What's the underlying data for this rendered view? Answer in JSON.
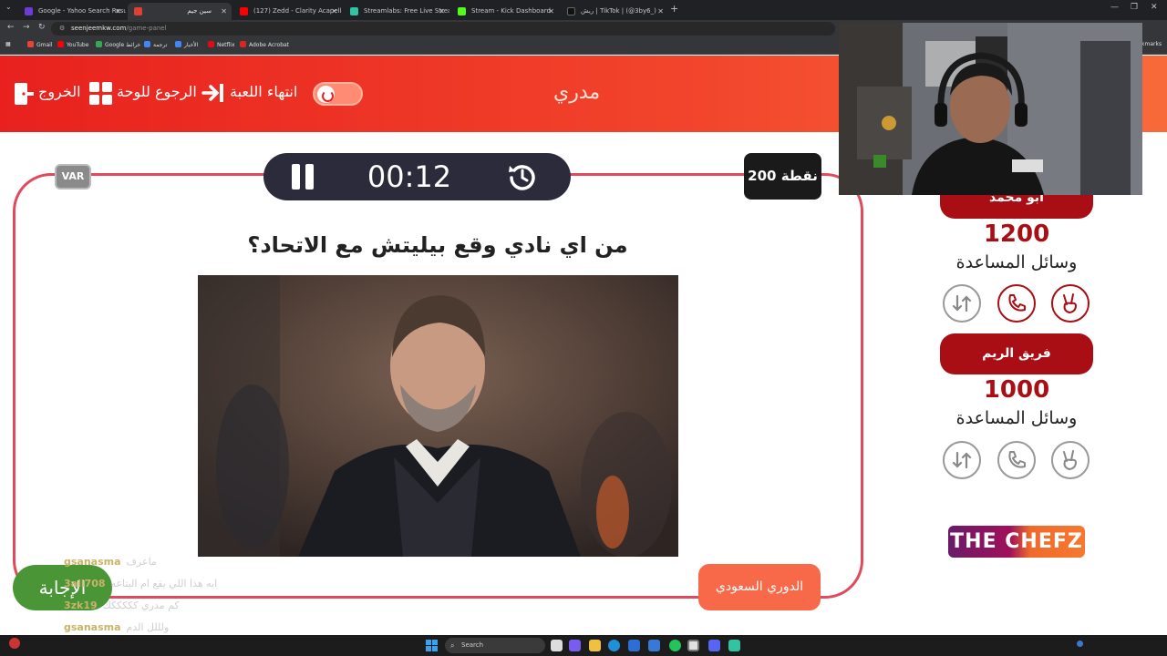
{
  "browser": {
    "tabs": [
      {
        "title": "Google - Yahoo Search Results",
        "color": "#6e3bd6",
        "active": false
      },
      {
        "title": "سين جيم",
        "color": "#e04030",
        "active": true
      },
      {
        "title": "(127) Zedd - Clarity Acapella C",
        "color": "#ff0000",
        "active": false
      },
      {
        "title": "Streamlabs: Free Live Streaming",
        "color": "#31c3a2",
        "active": false
      },
      {
        "title": "Stream - Kick Dashboard",
        "color": "#53fc18",
        "active": false
      },
      {
        "title": "ريش | TikTok | (@3by6_)",
        "color": "#111111",
        "active": false
      }
    ],
    "url_host": "seenjeemkw.com",
    "url_path": "/game-panel",
    "bookmarks": [
      {
        "label": "Gmail",
        "color": "#ea4335"
      },
      {
        "label": "YouTube",
        "color": "#ff0000"
      },
      {
        "label": "Google خرائط",
        "color": "#34a853"
      },
      {
        "label": "ترجمة",
        "color": "#4285f4"
      },
      {
        "label": "الأخبار",
        "color": "#4285f4"
      },
      {
        "label": "Netflix",
        "color": "#e50914"
      },
      {
        "label": "Adobe Acrobat",
        "color": "#d7271f"
      }
    ],
    "bookmarks_overflow": "kmarks"
  },
  "header": {
    "exit": "الخروج",
    "back_to_board": "الرجوع للوحة",
    "end_game": "انتهاء اللعبة",
    "brand": "مدري"
  },
  "game": {
    "var_label": "VAR",
    "timer": "00:12",
    "points": "200 نقطة",
    "question": "من اي نادي وقع بيليتش مع الاتحاد؟",
    "category": "الدوري السعودي",
    "answer_button": "الإجابة"
  },
  "chat": [
    {
      "user": "gsanasma",
      "message": "ماعرف"
    },
    {
      "user": "3ali708",
      "message": "ايه هذا اللي يقع ام البتاعه"
    },
    {
      "user": "3zk19",
      "message": "كم مدري كككككك"
    },
    {
      "user": "gsanasma",
      "message": "ولللل الدم"
    }
  ],
  "teams": [
    {
      "name": "ابو محمد",
      "score": "1200",
      "aids_label": "وسائل المساعدة"
    },
    {
      "name": "فريق الريم",
      "score": "1000",
      "aids_label": "وسائل المساعدة"
    }
  ],
  "sponsor_logo": "THE CHEFZ",
  "taskbar": {
    "search": "Search"
  },
  "colors": {
    "accent_red": "#e8211e",
    "team_red": "#a80e14",
    "frame_border": "#e04a5c",
    "category_orange": "#f8694a",
    "answer_green": "#4a9636"
  }
}
